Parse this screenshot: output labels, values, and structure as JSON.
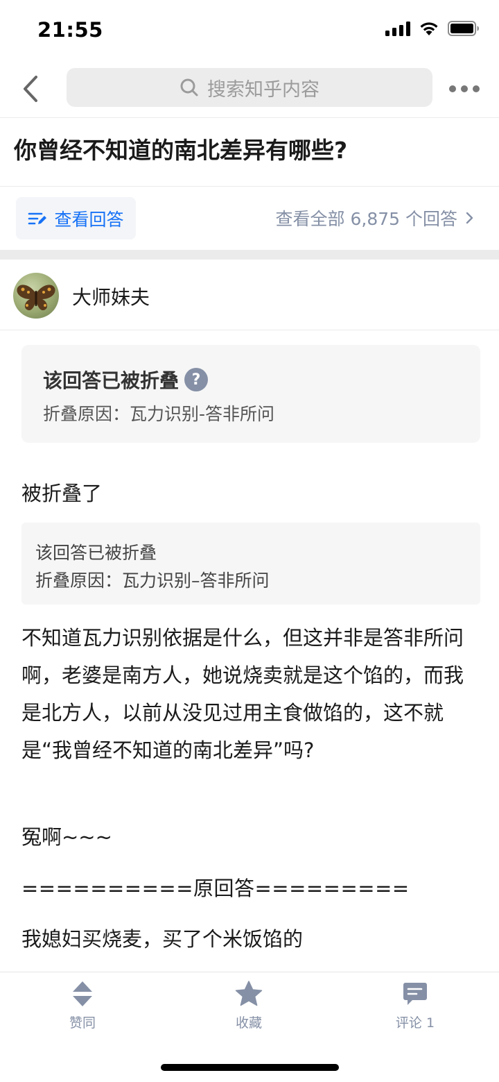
{
  "status_bar": {
    "time": "21:55",
    "icons": [
      "cellular-signal-icon",
      "wifi-icon",
      "battery-icon"
    ]
  },
  "nav": {
    "search_placeholder": "搜索知乎内容",
    "icons": [
      "back-arrow-icon",
      "search-icon",
      "more-icon"
    ]
  },
  "question": {
    "title": "你曾经不知道的南北差异有哪些?"
  },
  "answer_actions": {
    "view_answer_label": "查看回答",
    "view_all_label": "查看全部 6,875 个回答"
  },
  "author": {
    "name": "大师妹夫"
  },
  "collapsed_notice": {
    "title": "该回答已被折叠",
    "help_glyph": "?",
    "reason": "折叠原因：瓦力识别-答非所问"
  },
  "content": {
    "para_folded": "被折叠了",
    "quote_line_1": "该回答已被折叠",
    "quote_line_2": "折叠原因：瓦力识别–答非所问",
    "para_main": "不知道瓦力识别依据是什么，但这并非是答非所问啊，老婆是南方人，她说烧卖就是这个馅的，而我是北方人，以前从没见过用主食做馅的，这不就是“我曾经不知道的南北差异”吗?",
    "para_injustice": "冤啊~~~",
    "para_divider": "==========原回答=========",
    "para_original": "我媳妇买烧麦，买了个米饭馅的"
  },
  "toolbar": {
    "upvote_label": "赞同",
    "favorite_label": "收藏",
    "comment_label": "评论 1"
  },
  "colors": {
    "accent_blue": "#1772f6",
    "secondary_gray": "#8590a6",
    "divider": "#ebebeb"
  }
}
